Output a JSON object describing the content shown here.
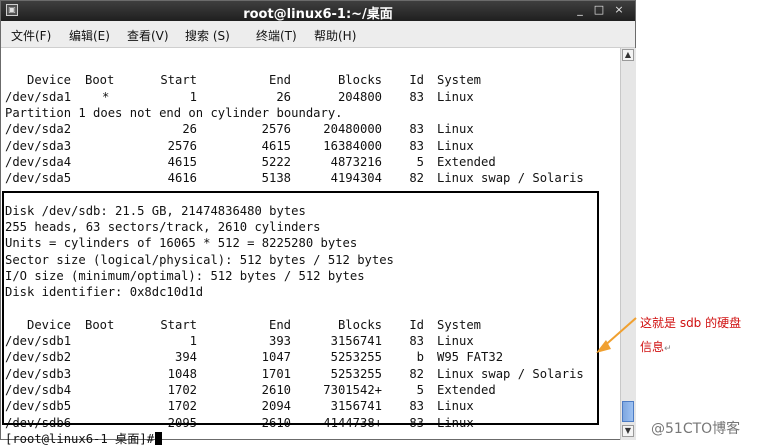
{
  "window": {
    "title": "root@linux6-1:~/桌面",
    "icon_name": "terminal-icon",
    "min_label": "_",
    "max_label": "□",
    "close_label": "×"
  },
  "menu": {
    "items": [
      "文件(F)",
      "编辑(E)",
      "查看(V)",
      "搜索 (S)",
      "终端(T)",
      "帮助(H)"
    ]
  },
  "sda_table": {
    "header": {
      "device": "Device",
      "boot": "Boot",
      "start": "Start",
      "end": "End",
      "blocks": "Blocks",
      "id": "Id",
      "system": "System"
    },
    "rows": [
      {
        "device": "/dev/sda1",
        "boot": "*",
        "start": "1",
        "end": "26",
        "blocks": "204800",
        "id": "83",
        "system": "Linux"
      },
      {
        "device": "/dev/sda2",
        "boot": "",
        "start": "26",
        "end": "2576",
        "blocks": "20480000",
        "id": "83",
        "system": "Linux"
      },
      {
        "device": "/dev/sda3",
        "boot": "",
        "start": "2576",
        "end": "4615",
        "blocks": "16384000",
        "id": "83",
        "system": "Linux"
      },
      {
        "device": "/dev/sda4",
        "boot": "",
        "start": "4615",
        "end": "5222",
        "blocks": "4873216",
        "id": "5",
        "system": "Extended"
      },
      {
        "device": "/dev/sda5",
        "boot": "",
        "start": "4616",
        "end": "5138",
        "blocks": "4194304",
        "id": "82",
        "system": "Linux swap / Solaris"
      }
    ],
    "note": "Partition 1 does not end on cylinder boundary."
  },
  "sdb_info": {
    "lines": [
      "Disk /dev/sdb: 21.5 GB, 21474836480 bytes",
      "255 heads, 63 sectors/track, 2610 cylinders",
      "Units = cylinders of 16065 * 512 = 8225280 bytes",
      "Sector size (logical/physical): 512 bytes / 512 bytes",
      "I/O size (minimum/optimal): 512 bytes / 512 bytes",
      "Disk identifier: 0x8dc10d1d"
    ]
  },
  "sdb_table": {
    "header": {
      "device": "Device",
      "boot": "Boot",
      "start": "Start",
      "end": "End",
      "blocks": "Blocks",
      "id": "Id",
      "system": "System"
    },
    "rows": [
      {
        "device": "/dev/sdb1",
        "boot": "",
        "start": "1",
        "end": "393",
        "blocks": "3156741",
        "id": "83",
        "system": "Linux"
      },
      {
        "device": "/dev/sdb2",
        "boot": "",
        "start": "394",
        "end": "1047",
        "blocks": "5253255",
        "id": "b",
        "system": "W95 FAT32"
      },
      {
        "device": "/dev/sdb3",
        "boot": "",
        "start": "1048",
        "end": "1701",
        "blocks": "5253255",
        "id": "82",
        "system": "Linux swap / Solaris"
      },
      {
        "device": "/dev/sdb4",
        "boot": "",
        "start": "1702",
        "end": "2610",
        "blocks": "7301542+",
        "id": "5",
        "system": "Extended"
      },
      {
        "device": "/dev/sdb5",
        "boot": "",
        "start": "1702",
        "end": "2094",
        "blocks": "3156741",
        "id": "83",
        "system": "Linux"
      },
      {
        "device": "/dev/sdb6",
        "boot": "",
        "start": "2095",
        "end": "2610",
        "blocks": "4144738+",
        "id": "83",
        "system": "Linux"
      }
    ]
  },
  "prompt": "[root@linux6-1 桌面]#",
  "annotation": {
    "line1": "这就是 sdb 的硬盘",
    "line2": "信息",
    "color": "#d01010",
    "arrow_color": "#f0a030"
  },
  "watermark": "@51CTO博客",
  "para_mark": "↵"
}
